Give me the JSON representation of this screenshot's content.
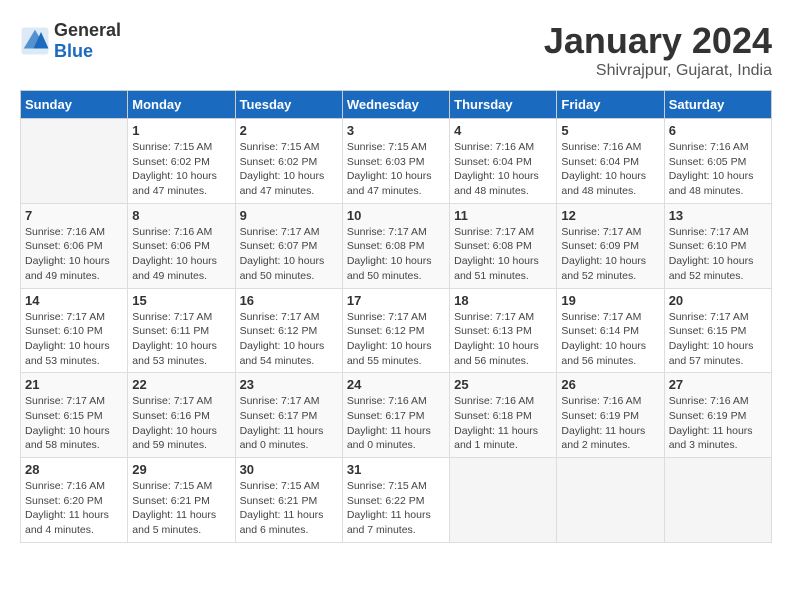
{
  "header": {
    "logo_general": "General",
    "logo_blue": "Blue",
    "month_year": "January 2024",
    "location": "Shivrajpur, Gujarat, India"
  },
  "calendar": {
    "days_of_week": [
      "Sunday",
      "Monday",
      "Tuesday",
      "Wednesday",
      "Thursday",
      "Friday",
      "Saturday"
    ],
    "weeks": [
      [
        {
          "day": "",
          "info": ""
        },
        {
          "day": "1",
          "info": "Sunrise: 7:15 AM\nSunset: 6:02 PM\nDaylight: 10 hours\nand 47 minutes."
        },
        {
          "day": "2",
          "info": "Sunrise: 7:15 AM\nSunset: 6:02 PM\nDaylight: 10 hours\nand 47 minutes."
        },
        {
          "day": "3",
          "info": "Sunrise: 7:15 AM\nSunset: 6:03 PM\nDaylight: 10 hours\nand 47 minutes."
        },
        {
          "day": "4",
          "info": "Sunrise: 7:16 AM\nSunset: 6:04 PM\nDaylight: 10 hours\nand 48 minutes."
        },
        {
          "day": "5",
          "info": "Sunrise: 7:16 AM\nSunset: 6:04 PM\nDaylight: 10 hours\nand 48 minutes."
        },
        {
          "day": "6",
          "info": "Sunrise: 7:16 AM\nSunset: 6:05 PM\nDaylight: 10 hours\nand 48 minutes."
        }
      ],
      [
        {
          "day": "7",
          "info": "Sunrise: 7:16 AM\nSunset: 6:06 PM\nDaylight: 10 hours\nand 49 minutes."
        },
        {
          "day": "8",
          "info": "Sunrise: 7:16 AM\nSunset: 6:06 PM\nDaylight: 10 hours\nand 49 minutes."
        },
        {
          "day": "9",
          "info": "Sunrise: 7:17 AM\nSunset: 6:07 PM\nDaylight: 10 hours\nand 50 minutes."
        },
        {
          "day": "10",
          "info": "Sunrise: 7:17 AM\nSunset: 6:08 PM\nDaylight: 10 hours\nand 50 minutes."
        },
        {
          "day": "11",
          "info": "Sunrise: 7:17 AM\nSunset: 6:08 PM\nDaylight: 10 hours\nand 51 minutes."
        },
        {
          "day": "12",
          "info": "Sunrise: 7:17 AM\nSunset: 6:09 PM\nDaylight: 10 hours\nand 52 minutes."
        },
        {
          "day": "13",
          "info": "Sunrise: 7:17 AM\nSunset: 6:10 PM\nDaylight: 10 hours\nand 52 minutes."
        }
      ],
      [
        {
          "day": "14",
          "info": "Sunrise: 7:17 AM\nSunset: 6:10 PM\nDaylight: 10 hours\nand 53 minutes."
        },
        {
          "day": "15",
          "info": "Sunrise: 7:17 AM\nSunset: 6:11 PM\nDaylight: 10 hours\nand 53 minutes."
        },
        {
          "day": "16",
          "info": "Sunrise: 7:17 AM\nSunset: 6:12 PM\nDaylight: 10 hours\nand 54 minutes."
        },
        {
          "day": "17",
          "info": "Sunrise: 7:17 AM\nSunset: 6:12 PM\nDaylight: 10 hours\nand 55 minutes."
        },
        {
          "day": "18",
          "info": "Sunrise: 7:17 AM\nSunset: 6:13 PM\nDaylight: 10 hours\nand 56 minutes."
        },
        {
          "day": "19",
          "info": "Sunrise: 7:17 AM\nSunset: 6:14 PM\nDaylight: 10 hours\nand 56 minutes."
        },
        {
          "day": "20",
          "info": "Sunrise: 7:17 AM\nSunset: 6:15 PM\nDaylight: 10 hours\nand 57 minutes."
        }
      ],
      [
        {
          "day": "21",
          "info": "Sunrise: 7:17 AM\nSunset: 6:15 PM\nDaylight: 10 hours\nand 58 minutes."
        },
        {
          "day": "22",
          "info": "Sunrise: 7:17 AM\nSunset: 6:16 PM\nDaylight: 10 hours\nand 59 minutes."
        },
        {
          "day": "23",
          "info": "Sunrise: 7:17 AM\nSunset: 6:17 PM\nDaylight: 11 hours\nand 0 minutes."
        },
        {
          "day": "24",
          "info": "Sunrise: 7:16 AM\nSunset: 6:17 PM\nDaylight: 11 hours\nand 0 minutes."
        },
        {
          "day": "25",
          "info": "Sunrise: 7:16 AM\nSunset: 6:18 PM\nDaylight: 11 hours\nand 1 minute."
        },
        {
          "day": "26",
          "info": "Sunrise: 7:16 AM\nSunset: 6:19 PM\nDaylight: 11 hours\nand 2 minutes."
        },
        {
          "day": "27",
          "info": "Sunrise: 7:16 AM\nSunset: 6:19 PM\nDaylight: 11 hours\nand 3 minutes."
        }
      ],
      [
        {
          "day": "28",
          "info": "Sunrise: 7:16 AM\nSunset: 6:20 PM\nDaylight: 11 hours\nand 4 minutes."
        },
        {
          "day": "29",
          "info": "Sunrise: 7:15 AM\nSunset: 6:21 PM\nDaylight: 11 hours\nand 5 minutes."
        },
        {
          "day": "30",
          "info": "Sunrise: 7:15 AM\nSunset: 6:21 PM\nDaylight: 11 hours\nand 6 minutes."
        },
        {
          "day": "31",
          "info": "Sunrise: 7:15 AM\nSunset: 6:22 PM\nDaylight: 11 hours\nand 7 minutes."
        },
        {
          "day": "",
          "info": ""
        },
        {
          "day": "",
          "info": ""
        },
        {
          "day": "",
          "info": ""
        }
      ]
    ]
  }
}
